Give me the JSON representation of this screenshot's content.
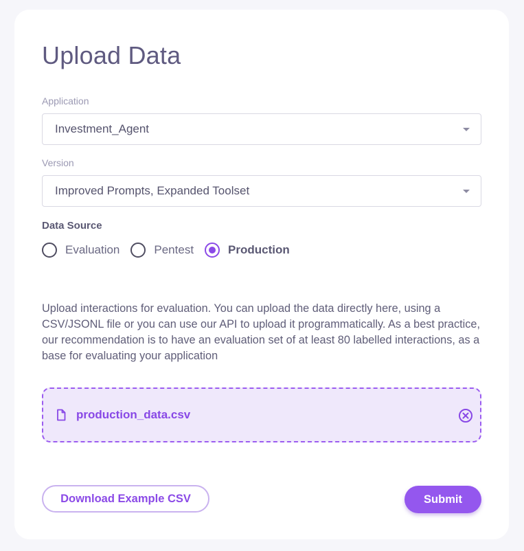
{
  "page": {
    "title": "Upload Data"
  },
  "form": {
    "application": {
      "label": "Application",
      "value": "Investment_Agent"
    },
    "version": {
      "label": "Version",
      "value": "Improved Prompts, Expanded Toolset"
    },
    "data_source": {
      "label": "Data Source",
      "options": [
        "Evaluation",
        "Pentest",
        "Production"
      ],
      "selected": "Production"
    },
    "description": "Upload interactions for evaluation. You can upload the data directly here, using a CSV/JSONL file or you can use our API to upload it programmatically. As a best practice, our recommendation is to have an evaluation set of at least 80 labelled interactions, as a base for evaluating your application",
    "uploaded_file": {
      "name": "production_data.csv",
      "icon": "file-icon",
      "remove_icon": "close-circle-icon"
    }
  },
  "actions": {
    "download_label": "Download Example CSV",
    "submit_label": "Submit"
  },
  "colors": {
    "accent": "#8b4ae7",
    "dropzone_bg": "#efe8fb",
    "page_bg": "#f6f6fa"
  }
}
